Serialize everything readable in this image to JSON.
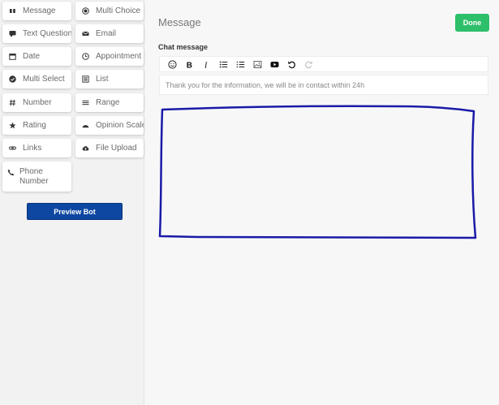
{
  "sidebar": {
    "tiles": [
      {
        "label": "Message",
        "icon": "quote-icon"
      },
      {
        "label": "Multi Choice",
        "icon": "radio-icon"
      },
      {
        "label": "Text Question",
        "icon": "chat-icon"
      },
      {
        "label": "Email",
        "icon": "envelope-icon"
      },
      {
        "label": "Date",
        "icon": "calendar-icon"
      },
      {
        "label": "Appointment",
        "icon": "clock-icon"
      },
      {
        "label": "Multi Select",
        "icon": "check-circle-icon"
      },
      {
        "label": "List",
        "icon": "list-icon"
      },
      {
        "label": "Number",
        "icon": "hash-icon"
      },
      {
        "label": "Range",
        "icon": "bars-icon"
      },
      {
        "label": "Rating",
        "icon": "star-icon"
      },
      {
        "label": "Opinion Scale",
        "icon": "gauge-icon"
      },
      {
        "label": "Links",
        "icon": "link-icon"
      },
      {
        "label": "File Upload",
        "icon": "cloud-upload-icon"
      },
      {
        "label": "Phone Number",
        "icon": "phone-icon"
      }
    ],
    "preview_label": "Preview Bot"
  },
  "main": {
    "title": "Message",
    "done_label": "Done",
    "field_label": "Chat message",
    "message_text": "Thank you for the information, we will be in contact within 24h",
    "toolbar": [
      "emoji",
      "bold",
      "italic",
      "bullet-list",
      "numbered-list",
      "image",
      "youtube",
      "undo",
      "redo"
    ]
  },
  "colors": {
    "primary": "#0d47a1",
    "success": "#2ebf6a",
    "annotation": "#1a1aa8"
  }
}
